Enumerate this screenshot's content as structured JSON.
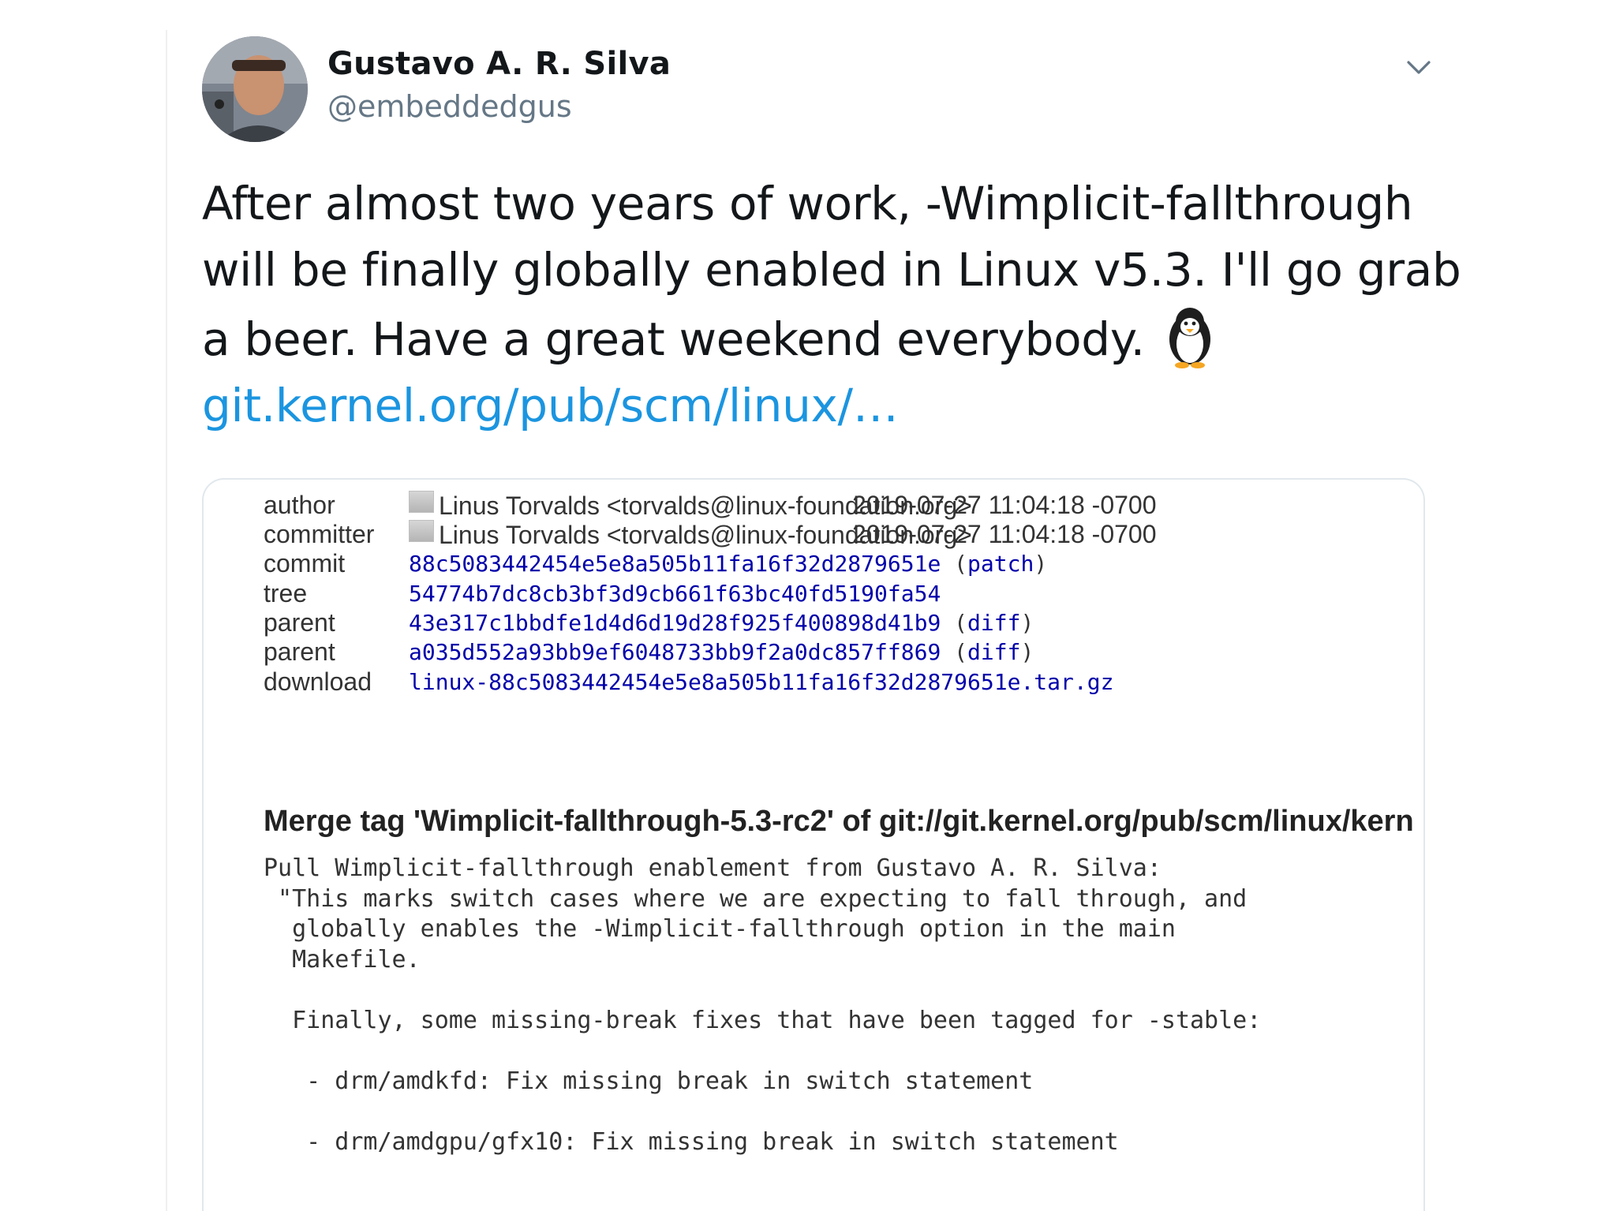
{
  "author": {
    "display_name": "Gustavo A. R. Silva",
    "handle": "@embeddedgus"
  },
  "tweet": {
    "line1": "After almost two years of work, -Wimplicit-fallthrough",
    "line2": "will be finally globally enabled in Linux v5.3.  I'll go grab",
    "line3": "a beer. Have a great weekend everybody.",
    "emoji": "penguin-emoji",
    "link": "git.kernel.org/pub/scm/linux/…"
  },
  "commit_card": {
    "rows": {
      "author_label": "author",
      "author_value": "Linus Torvalds <torvalds@linux-foundation.org>",
      "author_date": "2019-07-27 11:04:18 -0700",
      "committer_label": "committer",
      "committer_value": "Linus Torvalds <torvalds@linux-foundation.org>",
      "committer_date": "2019-07-27 11:04:18 -0700",
      "commit_label": "commit",
      "commit_hash": "88c5083442454e5e8a505b11fa16f32d2879651e",
      "commit_extra": "patch",
      "tree_label": "tree",
      "tree_hash": "54774b7dc8cb3bf3d9cb661f63bc40fd5190fa54",
      "parent1_label": "parent",
      "parent1_hash": "43e317c1bbdfe1d4d6d19d28f925f400898d41b9",
      "parent1_extra": "diff",
      "parent2_label": "parent",
      "parent2_hash": "a035d552a93bb9ef6048733bb9f2a0dc857ff869",
      "parent2_extra": "diff",
      "download_label": "download",
      "download_file": "linux-88c5083442454e5e8a505b11fa16f32d2879651e.tar.gz"
    },
    "merge_heading": "Merge tag 'Wimplicit-fallthrough-5.3-rc2' of git://git.kernel.org/pub/scm/linux/kern",
    "message": "Pull Wimplicit-fallthrough enablement from Gustavo A. R. Silva:\n \"This marks switch cases where we are expecting to fall through, and\n  globally enables the -Wimplicit-fallthrough option in the main\n  Makefile.\n\n  Finally, some missing-break fixes that have been tagged for -stable:\n\n   - drm/amdkfd: Fix missing break in switch statement\n\n   - drm/amdgpu/gfx10: Fix missing break in switch statement"
  },
  "colors": {
    "link_blue": "#1b95e0",
    "cgit_link": "#0000aa",
    "text_dark": "#14171a",
    "handle_gray": "#657786"
  }
}
